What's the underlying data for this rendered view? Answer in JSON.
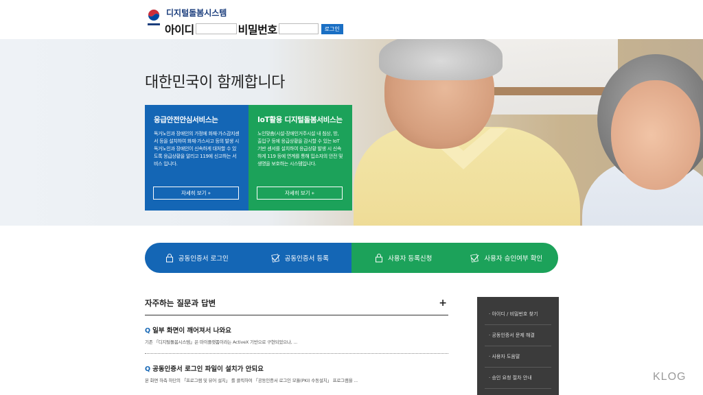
{
  "header": {
    "site_title": "디지털돌봄시스템",
    "id_label": "아이디",
    "id_value": "",
    "pw_label": "비밀번호",
    "pw_value": "",
    "login_button": "로그인"
  },
  "hero": {
    "title": "대한민국이 함께합니다",
    "cards": [
      {
        "title": "응급안전안심서비스는",
        "description": "독거노인과 장애인의 가정에 화재·가스감지센서 등을 설치하여 화재·가스사고 등의 발생 시 독거노인과 장애인이 신속하게 대처할 수 있도록 응급상황을 알리고 119에 신고하는 서비스 입니다.",
        "button": "자세히 보기 +",
        "color": "#1466b5"
      },
      {
        "title": "IoT활용 디지털돌봄서비스는",
        "description": "노인맞춤(시설·장애인거주시설 내 침상, 방, 출입구 등에 응급상황을 감시할 수 있는 IoT 기반 센서를 설치하여 응급상황 발생 시 신속하게 119 등에 연계를 통해 입소자의 안전 및 생명을 보호하는 시스템입니다.",
        "button": "자세히 보기 +",
        "color": "#1ca25a"
      }
    ]
  },
  "actions": [
    {
      "label": "공동인증서 로그인",
      "icon": "lock-icon"
    },
    {
      "label": "공동인증서 등록",
      "icon": "check-icon"
    },
    {
      "label": "사용자 등록신청",
      "icon": "lock-icon"
    },
    {
      "label": "사용자 승인여부 확인",
      "icon": "check-icon"
    }
  ],
  "faq": {
    "title": "자주하는 질문과 답변",
    "more": "+",
    "items": [
      {
        "q": "Q",
        "question": "일부 화면이 깨어져서 나와요",
        "answer": "기존 「디지털돌봄시스템」은 마이플랫폼이라는 ActiveX 기반으로 구현되었으나, ..."
      },
      {
        "q": "Q",
        "question": "공동인증서 로그인 파일이 설치가 안되요",
        "answer": "본 화면 하측 하단의 「프로그램 및 뷰어 설치」 를 클릭하여 「공동인증서 로그인 모듈(PKI) 수동설치」 프로그램을 ..."
      }
    ]
  },
  "quick_links": [
    "· 아이디 / 비밀번호 찾기",
    "· 공동인증서 문제 해결",
    "· 사용자 도움말",
    "· 승인 요청 절차 안내"
  ],
  "watermark": "KLOG"
}
